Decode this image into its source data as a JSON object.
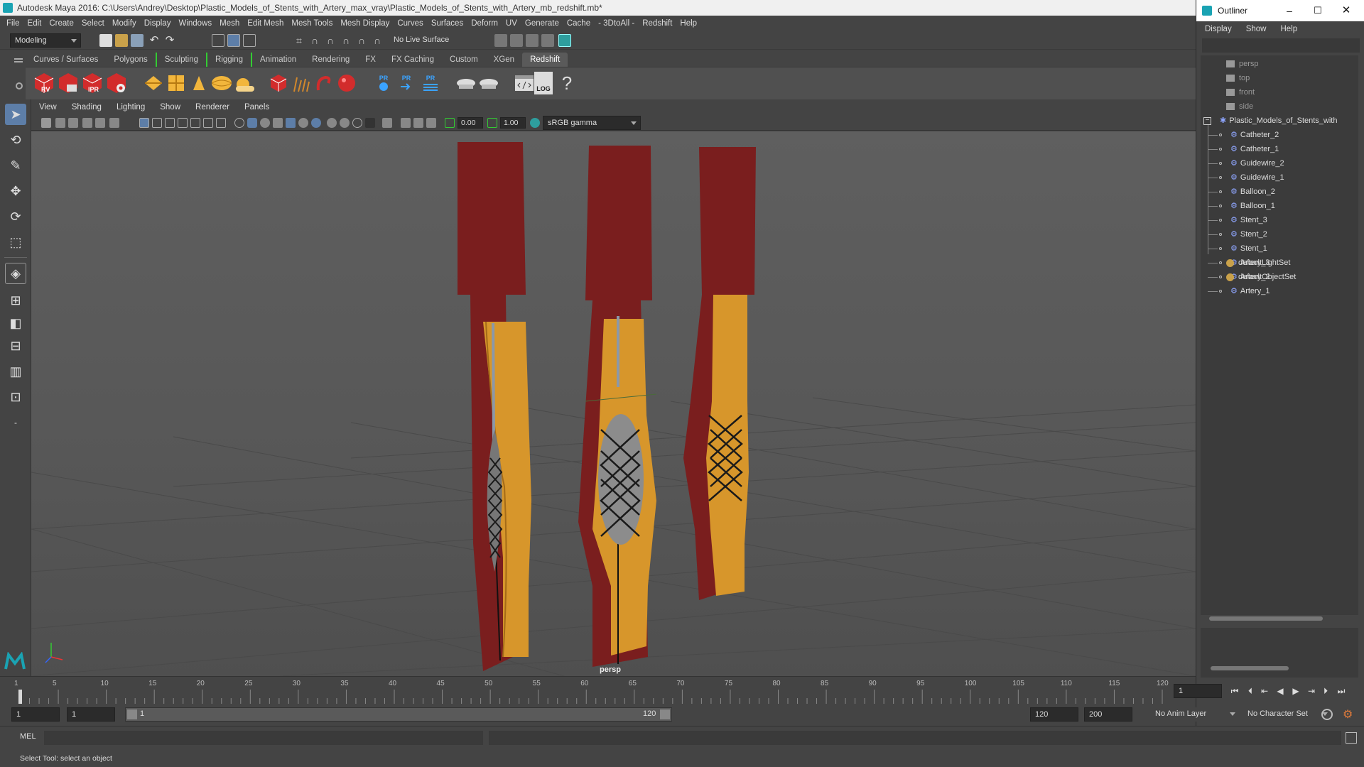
{
  "window": {
    "title": "Autodesk Maya 2016: C:\\Users\\Andrey\\Desktop\\Plastic_Models_of_Stents_with_Artery_max_vray\\Plastic_Models_of_Stents_with_Artery_mb_redshift.mb*"
  },
  "menubar": [
    "File",
    "Edit",
    "Create",
    "Select",
    "Modify",
    "Display",
    "Windows",
    "Mesh",
    "Edit Mesh",
    "Mesh Tools",
    "Mesh Display",
    "Curves",
    "Surfaces",
    "Deform",
    "UV",
    "Generate",
    "Cache",
    "- 3DtoAll -",
    "Redshift",
    "Help"
  ],
  "statusline": {
    "mode": "Modeling",
    "live_surface": "No Live Surface"
  },
  "shelf": {
    "tabs": [
      "Curves / Surfaces",
      "Polygons",
      "Sculpting",
      "Rigging",
      "Animation",
      "Rendering",
      "FX",
      "FX Caching",
      "Custom",
      "XGen",
      "Redshift"
    ],
    "active_tab": "Redshift",
    "icon_labels": [
      "RV",
      "IPR",
      "PR",
      "PR",
      "PR",
      "LOG",
      "?"
    ]
  },
  "panel": {
    "menu": [
      "View",
      "Shading",
      "Lighting",
      "Show",
      "Renderer",
      "Panels"
    ],
    "exposure": "0.00",
    "gamma": "1.00",
    "color_space": "sRGB gamma",
    "camera_label": "persp"
  },
  "outliner": {
    "title": "Outliner",
    "menu": [
      "Display",
      "Show",
      "Help"
    ],
    "cameras": [
      "persp",
      "top",
      "front",
      "side"
    ],
    "group": "Plastic_Models_of_Stents_with",
    "children": [
      "Catheter_2",
      "Catheter_1",
      "Guidewire_2",
      "Guidewire_1",
      "Balloon_2",
      "Balloon_1",
      "Stent_3",
      "Stent_2",
      "Stent_1",
      "Artery_3",
      "Artery_2",
      "Artery_1"
    ],
    "sets": [
      "defaultLightSet",
      "defaultObjectSet"
    ]
  },
  "timeline": {
    "ticks": [
      "5",
      "10",
      "15",
      "20",
      "25",
      "30",
      "35",
      "40",
      "45",
      "50",
      "55",
      "60",
      "65",
      "70",
      "75",
      "80",
      "85",
      "90",
      "95",
      "100",
      "105",
      "110",
      "115",
      "120"
    ],
    "start_tick": "1",
    "current_frame": "1"
  },
  "range": {
    "start": "1",
    "playback_start": "1",
    "slider_start": "1",
    "slider_end": "120",
    "playback_end": "120",
    "end": "200",
    "anim_layer": "No Anim Layer",
    "character_set": "No Character Set"
  },
  "command": {
    "label": "MEL"
  },
  "help": {
    "text": "Select Tool: select an object"
  },
  "colors": {
    "artery_outer": "#7a1e1e",
    "artery_inner": "#d7962b",
    "stent": "#1a1a1a",
    "balloon": "#8c8c8c",
    "redshift_red": "#d22c2c"
  }
}
